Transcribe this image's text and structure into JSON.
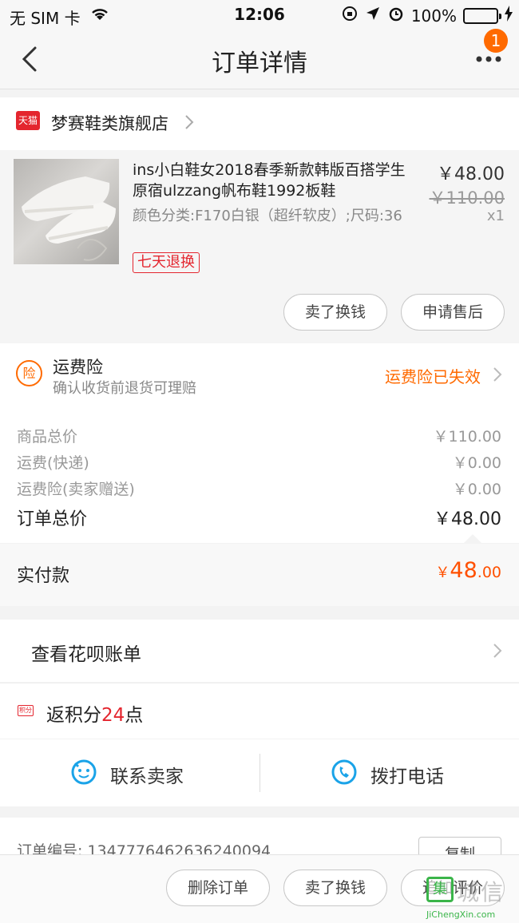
{
  "status_bar": {
    "carrier": "无 SIM 卡",
    "time": "12:06",
    "battery": "100%"
  },
  "nav": {
    "title": "订单详情",
    "badge_count": "1"
  },
  "store": {
    "badge_text": "天猫",
    "name": "梦赛鞋类旗舰店"
  },
  "item": {
    "title": "ins小白鞋女2018春季新款韩版百搭学生原宿ulzzang帆布鞋1992板鞋",
    "sku": "颜色分类:F170白银（超纤软皮）;尺码:36",
    "tag": "七天退换",
    "price": "￥48.00",
    "original_price": "￥110.00",
    "quantity": "x1",
    "actions": [
      "卖了换钱",
      "申请售后"
    ]
  },
  "insurance": {
    "icon_text": "险",
    "title": "运费险",
    "subtitle": "确认收货前退货可理赔",
    "status": "运费险已失效",
    "status_color": "#ff6a00"
  },
  "fees": [
    {
      "label": "商品总价",
      "value": "￥110.00"
    },
    {
      "label": "运费(快递)",
      "value": "￥0.00"
    },
    {
      "label": "运费险(卖家赠送)",
      "value": "￥0.00"
    }
  ],
  "order_total": {
    "label": "订单总价",
    "value": "￥48.00"
  },
  "paid": {
    "label": "实付款",
    "currency": "￥",
    "integer": "48",
    "decimal": ".00",
    "color": "#ff5000"
  },
  "huabei": {
    "label": "查看花呗账单"
  },
  "points": {
    "icon_text": "积分",
    "prefix": "返积分",
    "amount": "24",
    "suffix": "点"
  },
  "contact": {
    "seller_label": "联系卖家",
    "phone_label": "拨打电话"
  },
  "order_info": {
    "number_label": "订单编号:",
    "number_value": "1347776462636240094",
    "copy_label": "复制"
  },
  "bottom_bar": {
    "actions": [
      "删除订单",
      "卖了换钱",
      "追加评价"
    ]
  },
  "watermark": {
    "logo_text": "集",
    "brand": "城信",
    "url": "JiChengXin.com"
  }
}
